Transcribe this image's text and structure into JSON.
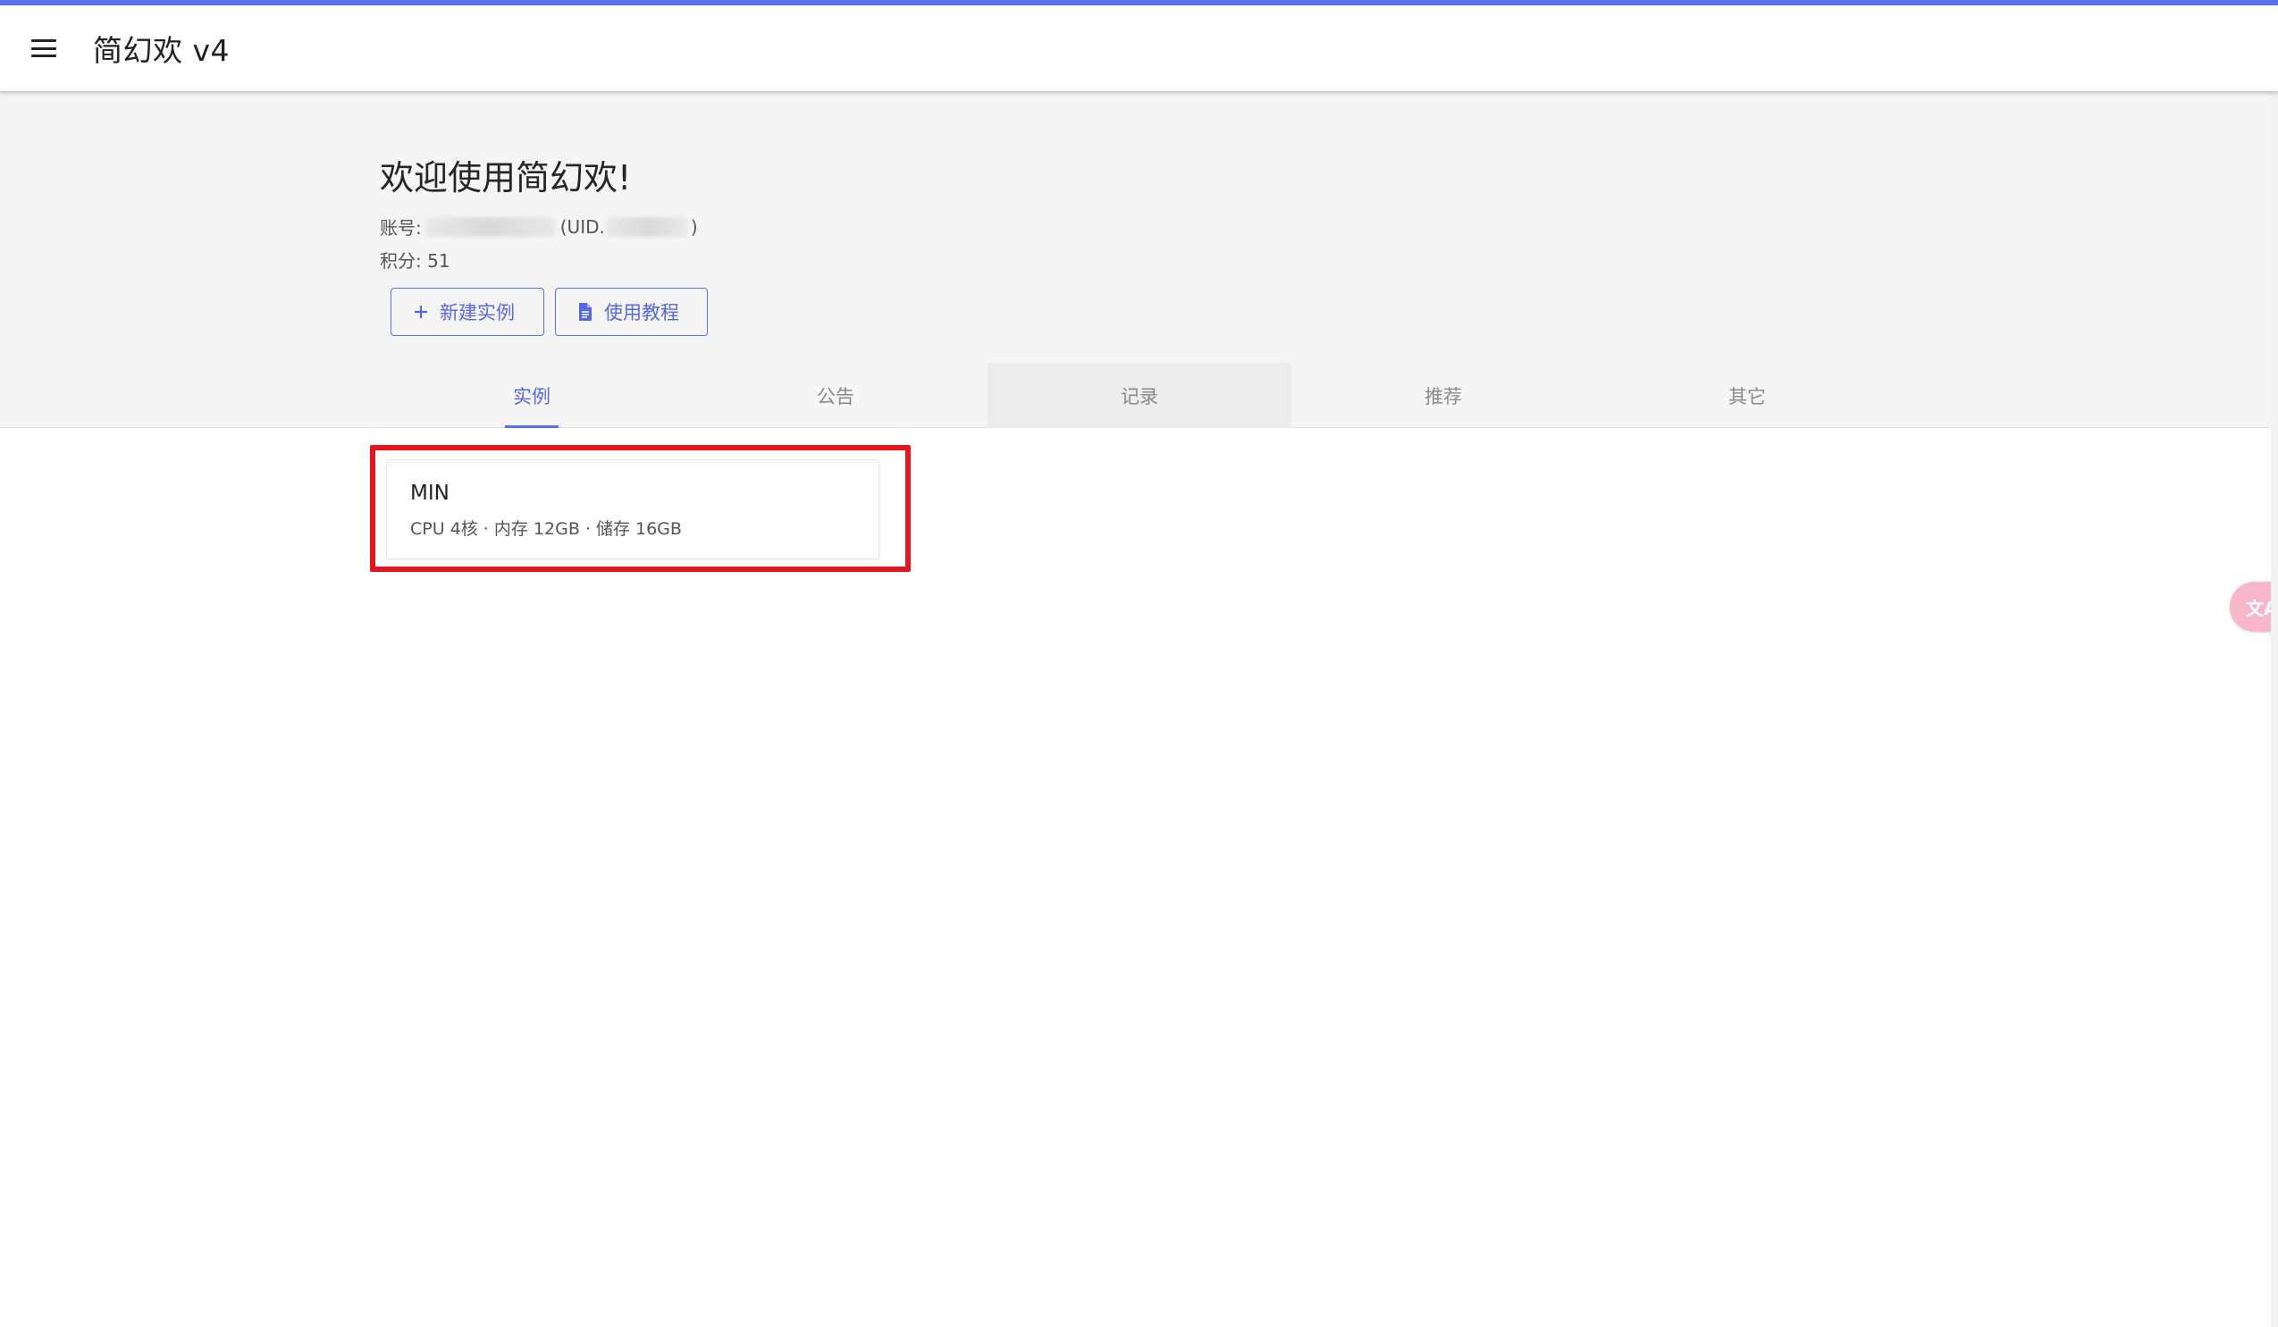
{
  "app": {
    "title": "简幻欢 v4",
    "accent_color": "#5b6ff1",
    "menu_icon": "menu-icon"
  },
  "header": {
    "welcome": "欢迎使用简幻欢!",
    "account_label": "账号:",
    "uid_prefix": "(UID.",
    "uid_suffix": ")",
    "points_text": "积分: 51"
  },
  "actions": {
    "new_instance": {
      "label": "新建实例",
      "icon": "plus-icon"
    },
    "tutorial": {
      "label": "使用教程",
      "icon": "document-icon"
    }
  },
  "tabs": [
    {
      "label": "实例",
      "active": true
    },
    {
      "label": "公告",
      "active": false
    },
    {
      "label": "记录",
      "active": false
    },
    {
      "label": "推荐",
      "active": false
    },
    {
      "label": "其它",
      "active": false
    }
  ],
  "instances": [
    {
      "name": "MIN",
      "specs": "CPU 4核 · 内存 12GB · 储存 16GB"
    }
  ],
  "highlight_color": "#e3151f",
  "translate_fab": {
    "icon": "translate-icon",
    "glyph": "文A",
    "color": "#f7b6c9"
  }
}
